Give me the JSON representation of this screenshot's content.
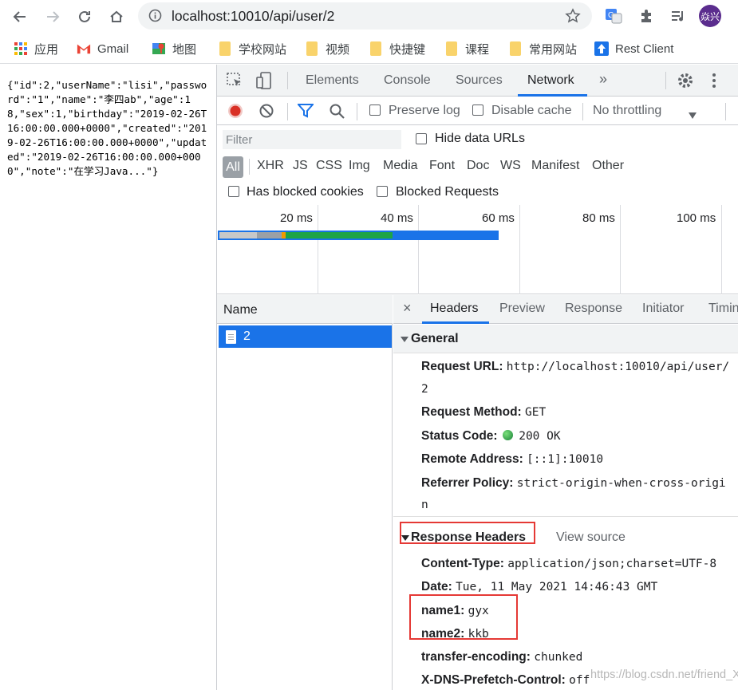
{
  "browser": {
    "url": "localhost:10010/api/user/2",
    "avatar_text": "焱兴",
    "icons": [
      "back-icon",
      "forward-icon",
      "reload-icon",
      "home-icon",
      "info-icon",
      "star-icon",
      "translate-icon",
      "extension-icon",
      "media-icon"
    ]
  },
  "bookmarks": [
    {
      "label": "应用",
      "icon": "apps-icon"
    },
    {
      "label": "Gmail",
      "icon": "gmail-icon"
    },
    {
      "label": "地图",
      "icon": "maps-icon"
    },
    {
      "label": "学校网站",
      "icon": "folder-icon"
    },
    {
      "label": "视频",
      "icon": "folder-icon"
    },
    {
      "label": "快捷键",
      "icon": "folder-icon"
    },
    {
      "label": "课程",
      "icon": "folder-icon"
    },
    {
      "label": "常用网站",
      "icon": "folder-icon"
    },
    {
      "label": "Rest Client",
      "icon": "rest-client-icon"
    }
  ],
  "page": {
    "json_text": "{\"id\":2,\"userName\":\"lisi\",\"password\":\"1\",\"name\":\"李四ab\",\"age\":18,\"sex\":1,\"birthday\":\"2019-02-26T16:00:00.000+0000\",\"created\":\"2019-02-26T16:00:00.000+0000\",\"updated\":\"2019-02-26T16:00:00.000+0000\",\"note\":\"在学习Java...\"}"
  },
  "devtools": {
    "tabs": [
      "Elements",
      "Console",
      "Sources",
      "Network"
    ],
    "active_tab": "Network",
    "more": "»",
    "toolbar": {
      "preserve_log": "Preserve log",
      "disable_cache": "Disable cache",
      "throttling": "No throttling"
    },
    "filter": {
      "placeholder": "Filter",
      "hide_data_urls": "Hide data URLs",
      "types": [
        "All",
        "XHR",
        "JS",
        "CSS",
        "Img",
        "Media",
        "Font",
        "Doc",
        "WS",
        "Manifest",
        "Other"
      ],
      "has_blocked_cookies": "Has blocked cookies",
      "blocked_requests": "Blocked Requests"
    },
    "timeline": {
      "ticks": [
        "20 ms",
        "40 ms",
        "60 ms",
        "80 ms",
        "100 ms"
      ]
    },
    "requests": {
      "column": "Name",
      "items": [
        "2"
      ]
    },
    "details": {
      "close": "×",
      "tabs": [
        "Headers",
        "Preview",
        "Response",
        "Initiator",
        "Timing"
      ],
      "general": {
        "title": "General",
        "request_url_key": "Request URL:",
        "request_url_line1": "http://localhost:10010/api/user/",
        "request_url_line2": "2",
        "method_key": "Request Method:",
        "method_val": "GET",
        "status_key": "Status Code:",
        "status_val": "200 OK",
        "remote_key": "Remote Address:",
        "remote_val": "[::1]:10010",
        "referrer_key": "Referrer Policy:",
        "referrer_line1": "strict-origin-when-cross-origi",
        "referrer_line2": "n"
      },
      "response_headers": {
        "title": "Response Headers",
        "view_source": "View source",
        "rows": [
          {
            "k": "Content-Type:",
            "v": "application/json;charset=UTF-8"
          },
          {
            "k": "Date:",
            "v": "Tue, 11 May 2021 14:46:43 GMT"
          },
          {
            "k": "name1:",
            "v": "gyx"
          },
          {
            "k": "name2:",
            "v": "kkb"
          },
          {
            "k": "transfer-encoding:",
            "v": "chunked"
          },
          {
            "k": "X-DNS-Prefetch-Control:",
            "v": "off"
          }
        ]
      }
    }
  },
  "watermark": "https://blog.csdn.net/friend_X",
  "colors": {
    "accent": "#1a73e8",
    "record": "#d93025",
    "status_green": "#188038",
    "highlight_box": "#e53935"
  }
}
